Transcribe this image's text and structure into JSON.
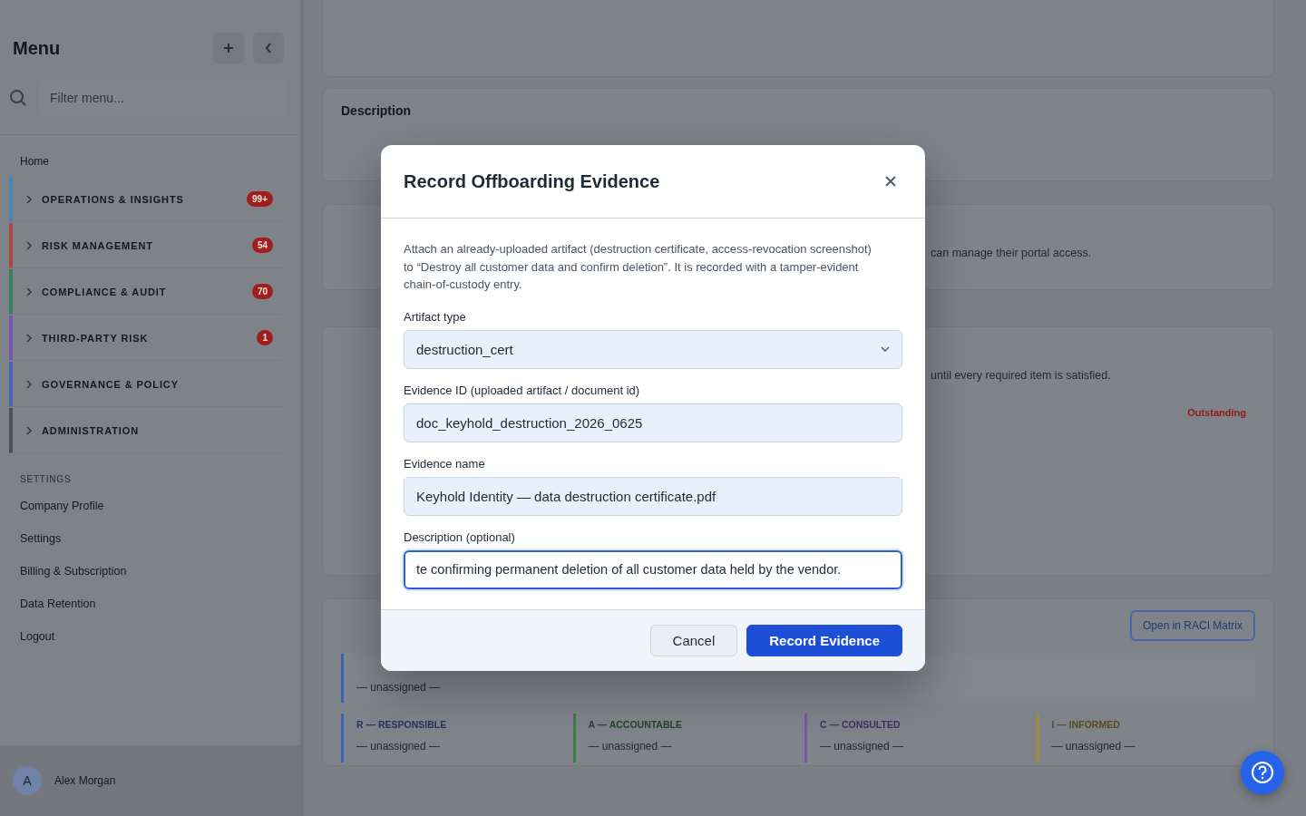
{
  "sidebar": {
    "title": "Menu",
    "filter": {
      "placeholder": "Filter menu..."
    },
    "home": "Home",
    "groups": [
      {
        "label": "OPERATIONS & INSIGHTS",
        "color": "#4a86b0",
        "badge": "99+"
      },
      {
        "label": "RISK MANAGEMENT",
        "color": "#a84848",
        "badge": "54"
      },
      {
        "label": "COMPLIANCE & AUDIT",
        "color": "#3b7f63",
        "badge": "70"
      },
      {
        "label": "THIRD-PARTY RISK",
        "color": "#7a55b0",
        "badge": "1"
      },
      {
        "label": "GOVERNANCE & POLICY",
        "color": "#4a64b0"
      },
      {
        "label": "ADMINISTRATION",
        "color": "#4d5259"
      }
    ],
    "settings_heading": "SETTINGS",
    "settings_items": [
      "Company Profile",
      "Settings",
      "Billing & Subscription",
      "Data Retention",
      "Logout"
    ],
    "user": {
      "initial": "A",
      "name": "Alex Morgan"
    }
  },
  "main": {
    "description": {
      "heading": "Description"
    },
    "vendor_contacts": {
      "text_tail": "can manage their portal access."
    },
    "checklist": {
      "text_tail": "until every required item is satisfied.",
      "status": "Outstanding"
    },
    "raci": {
      "open_button": "Open in RACI Matrix",
      "owner_value": "— unassigned —",
      "roles": [
        {
          "label": "R — RESPONSIBLE",
          "color": "#3f62b0",
          "value": "— unassigned —"
        },
        {
          "label": "A — ACCOUNTABLE",
          "color": "#3f7d48",
          "value": "— unassigned —"
        },
        {
          "label": "C — CONSULTED",
          "color": "#7a55b0",
          "value": "— unassigned —"
        },
        {
          "label": "I — INFORMED",
          "color": "#a38a35",
          "value": "— unassigned —"
        }
      ]
    }
  },
  "dialog": {
    "title": "Record Offboarding Evidence",
    "intro": "Attach an already-uploaded artifact (destruction certificate, access-revocation screenshot) to “Destroy all customer data and confirm deletion”. It is recorded with a tamper-evident chain-of-custody entry.",
    "fields": [
      {
        "kind": "select",
        "label": "Artifact type",
        "value": "destruction_cert",
        "focused": false
      },
      {
        "kind": "text",
        "label": "Evidence ID (uploaded artifact / document id)",
        "value": "doc_keyhold_destruction_2026_0625",
        "focused": false
      },
      {
        "kind": "text",
        "label": "Evidence name",
        "value": "Keyhold Identity — data destruction certificate.pdf",
        "focused": false
      },
      {
        "kind": "text",
        "label": "Description (optional)",
        "value": "te confirming permanent deletion of all customer data held by the vendor.",
        "focused": true
      }
    ],
    "buttons": [
      {
        "kind": "secondary",
        "label": "Cancel"
      },
      {
        "kind": "primary",
        "label": "Record Evidence"
      }
    ]
  }
}
